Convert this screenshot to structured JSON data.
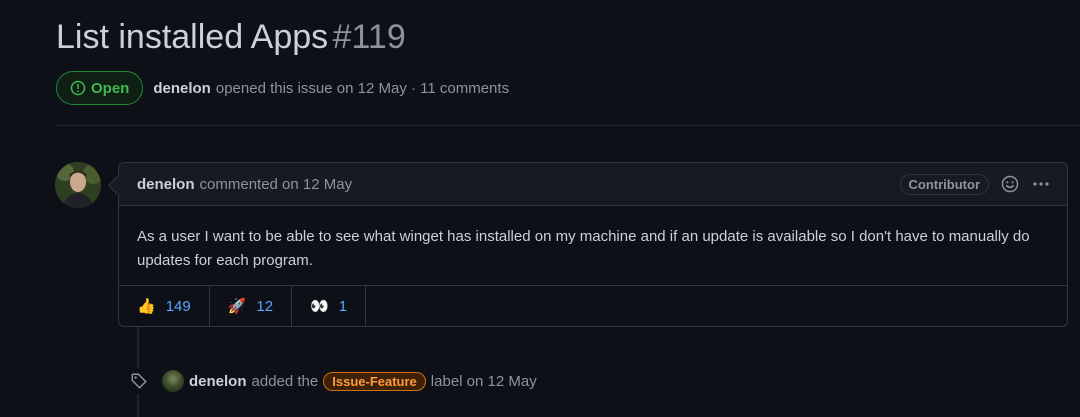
{
  "issue": {
    "title": "List installed Apps",
    "number": "#119",
    "state": "Open",
    "author": "denelon",
    "opened_text": "opened this issue on 12 May · 11 comments"
  },
  "comment": {
    "author": "denelon",
    "meta": "commented on 12 May",
    "role": "Contributor",
    "body": "As a user I want to be able to see what winget has installed on my machine and if an update is available so I don't have to manually do updates for each program.",
    "reactions": [
      {
        "emoji": "👍",
        "count": "149"
      },
      {
        "emoji": "🚀",
        "count": "12"
      },
      {
        "emoji": "👀",
        "count": "1"
      }
    ]
  },
  "event": {
    "author": "denelon",
    "action": "added the",
    "label": "Issue-Feature",
    "suffix": "label on 12 May"
  },
  "colors": {
    "background": "#0d1117",
    "open_green": "#3fb950",
    "link_blue": "#58a6ff",
    "label_orange": "#ff9a3c"
  }
}
